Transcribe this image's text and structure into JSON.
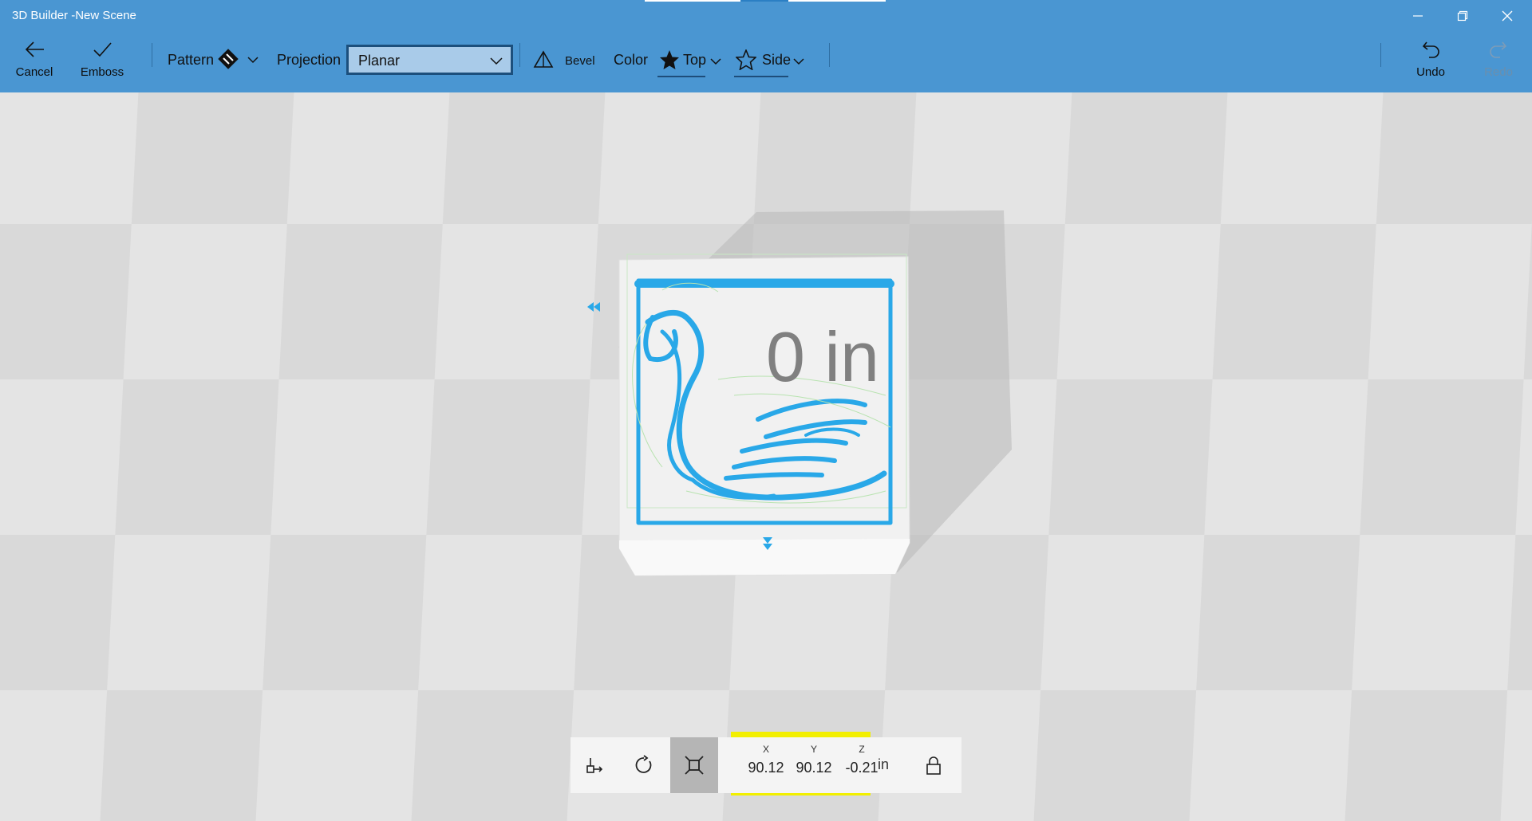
{
  "window": {
    "title": "3D Builder -New Scene",
    "controls": [
      "minimize-icon",
      "restore-icon",
      "close-icon"
    ]
  },
  "toolbar": {
    "cancel_label": "Cancel",
    "emboss_label": "Emboss",
    "pattern_label": "Pattern",
    "projection_label": "Projection",
    "projection_value": "Planar",
    "bevel_label": "Bevel",
    "color_label": "Color",
    "top_label": "Top",
    "side_label": "Side",
    "undo_label": "Undo",
    "redo_label": "Redo"
  },
  "scene": {
    "depth_label": "0 in",
    "accent_color": "#29a8e8"
  },
  "transform_bar": {
    "tools": [
      "move-icon",
      "rotate-icon",
      "scale-icon"
    ],
    "selected_tool": "scale-icon",
    "x_axis": "X",
    "y_axis": "Y",
    "z_axis": "Z",
    "x_value": "90.12",
    "y_value": "90.12",
    "z_value": "-0.21",
    "unit": "in",
    "highlight_color": "#f2ef00"
  }
}
